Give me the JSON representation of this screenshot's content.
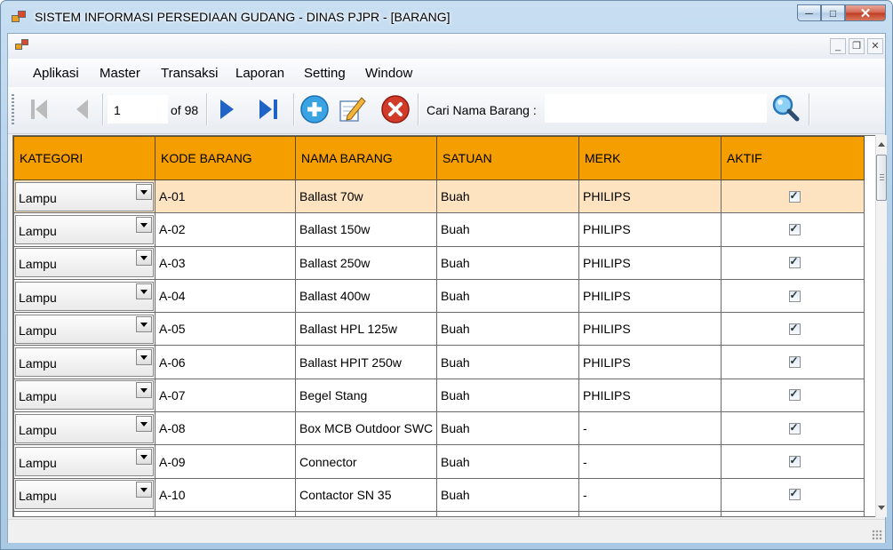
{
  "window": {
    "title": "SISTEM INFORMASI PERSEDIAAN GUDANG - DINAS PJPR - [BARANG]"
  },
  "menu": [
    "Aplikasi",
    "Master",
    "Transaksi",
    "Laporan",
    "Setting",
    "Window"
  ],
  "navigator": {
    "position": "1",
    "of_label": "of 98"
  },
  "search": {
    "label": "Cari Nama Barang :",
    "value": ""
  },
  "grid": {
    "columns": [
      "KATEGORI",
      "KODE BARANG",
      "NAMA BARANG",
      "SATUAN",
      "MERK",
      "AKTIF"
    ],
    "rows": [
      {
        "kategori": "Lampu",
        "kode": "A-01",
        "nama": "Ballast 70w",
        "satuan": "Buah",
        "merk": "PHILIPS",
        "aktif": true
      },
      {
        "kategori": "Lampu",
        "kode": "A-02",
        "nama": "Ballast 150w",
        "satuan": "Buah",
        "merk": "PHILIPS",
        "aktif": true
      },
      {
        "kategori": "Lampu",
        "kode": "A-03",
        "nama": "Ballast 250w",
        "satuan": "Buah",
        "merk": "PHILIPS",
        "aktif": true
      },
      {
        "kategori": "Lampu",
        "kode": "A-04",
        "nama": "Ballast 400w",
        "satuan": "Buah",
        "merk": "PHILIPS",
        "aktif": true
      },
      {
        "kategori": "Lampu",
        "kode": "A-05",
        "nama": "Ballast HPL 125w",
        "satuan": "Buah",
        "merk": "PHILIPS",
        "aktif": true
      },
      {
        "kategori": "Lampu",
        "kode": "A-06",
        "nama": "Ballast HPIT 250w",
        "satuan": "Buah",
        "merk": "PHILIPS",
        "aktif": true
      },
      {
        "kategori": "Lampu",
        "kode": "A-07",
        "nama": "Begel Stang",
        "satuan": "Buah",
        "merk": "PHILIPS",
        "aktif": true
      },
      {
        "kategori": "Lampu",
        "kode": "A-08",
        "nama": "Box MCB Outdoor SWC",
        "satuan": "Buah",
        "merk": "-",
        "aktif": true
      },
      {
        "kategori": "Lampu",
        "kode": "A-09",
        "nama": "Connector",
        "satuan": "Buah",
        "merk": "-",
        "aktif": true
      },
      {
        "kategori": "Lampu",
        "kode": "A-10",
        "nama": "Contactor SN 35",
        "satuan": "Buah",
        "merk": "-",
        "aktif": true
      }
    ]
  },
  "colors": {
    "header_bg": "#f59e00",
    "selected_row_bg": "#fde3c0"
  },
  "icons": [
    "move-first-icon",
    "move-previous-icon",
    "move-next-icon",
    "move-last-icon",
    "add-icon",
    "edit-icon",
    "delete-icon",
    "search-icon"
  ]
}
